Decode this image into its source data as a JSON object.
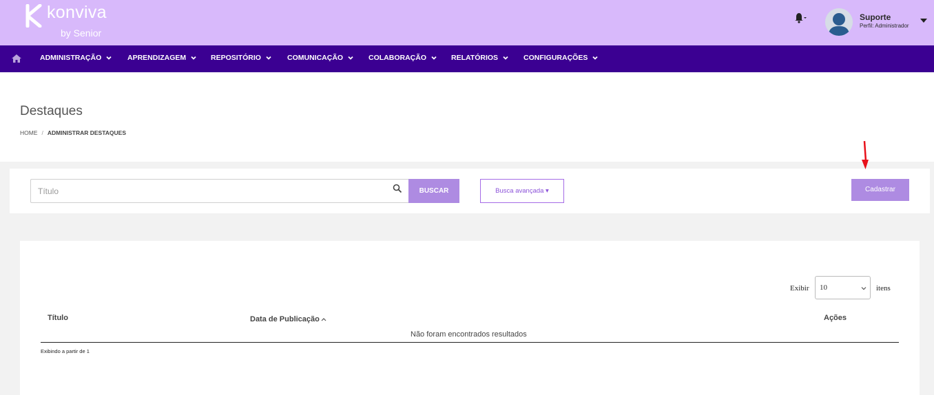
{
  "header": {
    "brand": "konviva",
    "brand_sub": "by Senior",
    "user_name": "Suporte",
    "user_role": "Perfil: Administrador"
  },
  "nav": {
    "items": [
      {
        "label": "ADMINISTRAÇÃO"
      },
      {
        "label": "APRENDIZAGEM"
      },
      {
        "label": "REPOSITÓRIO"
      },
      {
        "label": "COMUNICAÇÃO"
      },
      {
        "label": "COLABORAÇÃO"
      },
      {
        "label": "RELATÓRIOS"
      },
      {
        "label": "CONFIGURAÇÕES"
      }
    ]
  },
  "page": {
    "title": "Destaques",
    "breadcrumb": {
      "home": "HOME",
      "separator": "/",
      "current": "ADMINISTRAR DESTAQUES"
    }
  },
  "search": {
    "placeholder": "Título",
    "buscar_label": "BUSCAR",
    "advanced_label": "Busca avançada ▾",
    "cadastrar_label": "Cadastrar"
  },
  "table": {
    "exibir_label": "Exibir",
    "page_size": "10",
    "itens_label": "itens",
    "columns": [
      {
        "label": "Título"
      },
      {
        "label": "Data de Publicação"
      },
      {
        "label": "Ações"
      }
    ],
    "empty_message": "Não foram encontrados resultados",
    "pager_info": "Exibindo a partir de 1"
  },
  "colors": {
    "header_bg": "#d8b9fb",
    "nav_bg": "#3b0092",
    "accent": "#ae8be2",
    "arrow": "#e8101a"
  }
}
